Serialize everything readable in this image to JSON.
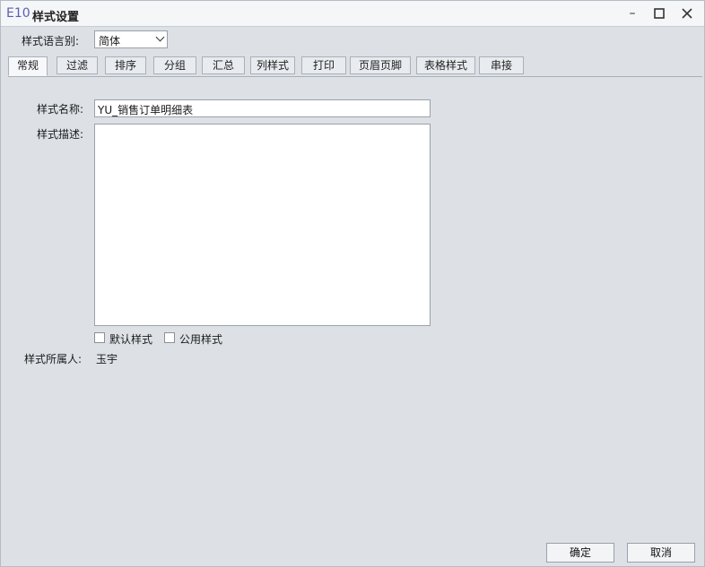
{
  "window": {
    "logo": "E10",
    "title": "样式设置",
    "controls": {
      "minimize": "–",
      "maximize": "☐",
      "close": "✕"
    }
  },
  "language": {
    "label": "样式语言别:",
    "selected": "简体"
  },
  "tabs": [
    {
      "label": "常规",
      "active": true
    },
    {
      "label": "过滤",
      "active": false
    },
    {
      "label": "排序",
      "active": false
    },
    {
      "label": "分组",
      "active": false
    },
    {
      "label": "汇总",
      "active": false
    },
    {
      "label": "列样式",
      "active": false
    },
    {
      "label": "打印",
      "active": false
    },
    {
      "label": "页眉页脚",
      "active": false
    },
    {
      "label": "表格样式",
      "active": false
    },
    {
      "label": "串接",
      "active": false
    }
  ],
  "form": {
    "name_label": "样式名称:",
    "name_value": "YU_销售订单明细表",
    "desc_label": "样式描述:",
    "desc_value": "",
    "default_style_label": "默认样式",
    "default_style_checked": false,
    "public_style_label": "公用样式",
    "public_style_checked": false,
    "owner_label": "样式所属人:",
    "owner_value": "玉宇"
  },
  "footer": {
    "ok_label": "确定",
    "cancel_label": "取消"
  }
}
